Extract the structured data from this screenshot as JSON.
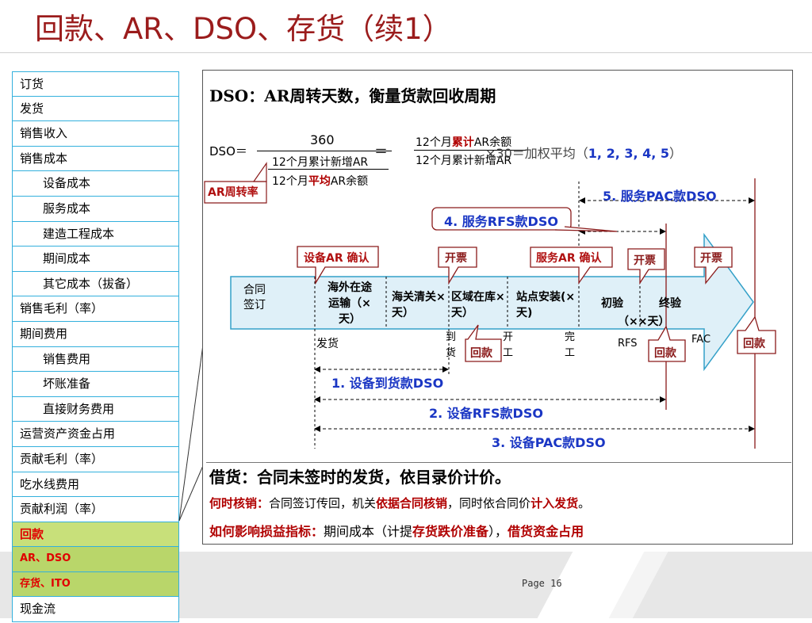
{
  "title": "回款、AR、DSO、存货（续1）",
  "page": "Page 16",
  "sidebar": [
    {
      "label": "订货",
      "level": 0
    },
    {
      "label": "发货",
      "level": 0
    },
    {
      "label": "销售收入",
      "level": 0
    },
    {
      "label": "销售成本",
      "level": 0
    },
    {
      "label": "设备成本",
      "level": 1
    },
    {
      "label": "服务成本",
      "level": 1
    },
    {
      "label": "建造工程成本",
      "level": 1
    },
    {
      "label": "期间成本",
      "level": 1
    },
    {
      "label": "其它成本（拔备）",
      "level": 1
    },
    {
      "label": "销售毛利（率）",
      "level": 0
    },
    {
      "label": "期间费用",
      "level": 0
    },
    {
      "label": "销售费用",
      "level": 1
    },
    {
      "label": "坏账准备",
      "level": 1
    },
    {
      "label": "直接财务费用",
      "level": 1
    },
    {
      "label": "运营资产资金占用",
      "level": 0
    },
    {
      "label": "贡献毛利（率）",
      "level": 0
    },
    {
      "label": "吃水线费用",
      "level": 0
    },
    {
      "label": "贡献利润（率）",
      "level": 0
    },
    {
      "label": "回款",
      "level": 0,
      "highlight": true
    },
    {
      "label": "AR、DSO",
      "level": 0,
      "highlight": true
    },
    {
      "label": "存货、ITO",
      "level": 0,
      "highlight": true
    },
    {
      "label": "现金流",
      "level": 0
    }
  ],
  "panel": {
    "heading": "DSO：AR周转天数，衡量货款回收周期",
    "formula": {
      "lhs": "DSO＝",
      "num1": "360",
      "den1_top": "12个月累计新增AR",
      "den1_bot_a": "12个月",
      "den1_bot_b": "平均",
      "den1_bot_c": "AR余额",
      "eq": "＝",
      "num2_a": "12个月",
      "num2_b": "累计",
      "num2_c": "AR余额",
      "den2": "12个月累计新增AR",
      "times": "×30＝加权平均（",
      "nums": "1, 2, 3, 4, 5",
      "close": "）",
      "ar_label": "AR周转率"
    },
    "stages": [
      {
        "label": "合同签订"
      },
      {
        "label": "海外在途运输（×天）"
      },
      {
        "label": "海关清关×天）"
      },
      {
        "label": "区域在库×天）"
      },
      {
        "label": "站点安装(×天)"
      },
      {
        "label": "初验"
      },
      {
        "label": "终验"
      },
      {
        "label": "（××天）"
      }
    ],
    "callouts": {
      "equip_ar": "设备AR 确认",
      "invoice": "开票",
      "service_ar": "服务AR 确认",
      "payment": "回款"
    },
    "milestones": {
      "ship": "发货",
      "arrive": "到货",
      "start": "开工",
      "done": "完工",
      "rfs": "RFS",
      "fac": "FAC"
    },
    "ranges": [
      "1. 设备到货款DSO",
      "2. 设备RFS款DSO",
      "3. 设备PAC款DSO",
      "4. 服务RFS款DSO",
      "5. 服务PAC款DSO"
    ],
    "loan": {
      "title": "借货：合同未签时的发货，依目录价计价。",
      "when_label": "何时核销：",
      "when_text_a": "合同签订传回，机关",
      "when_text_b": "依据合同核销",
      "when_text_c": "，同时依合同价",
      "when_text_d": "计入发货",
      "when_text_e": "。",
      "impact_label": "如何影响损益指标：",
      "impact_text_a": "期间成本（计提",
      "impact_text_b": "存货跌价准备",
      "impact_text_c": "），",
      "impact_text_d": "借货资金占用"
    }
  },
  "colors": {
    "title": "#9b1c1c",
    "sidebar_border": "#33b0dd",
    "highlight_bg": "#c8e07a",
    "highlight_text": "#e00000",
    "range_text": "#1a36c4",
    "callout_border": "#8a1a1a",
    "arrow_fill": "#dff0f8",
    "arrow_border": "#33a0c8"
  }
}
